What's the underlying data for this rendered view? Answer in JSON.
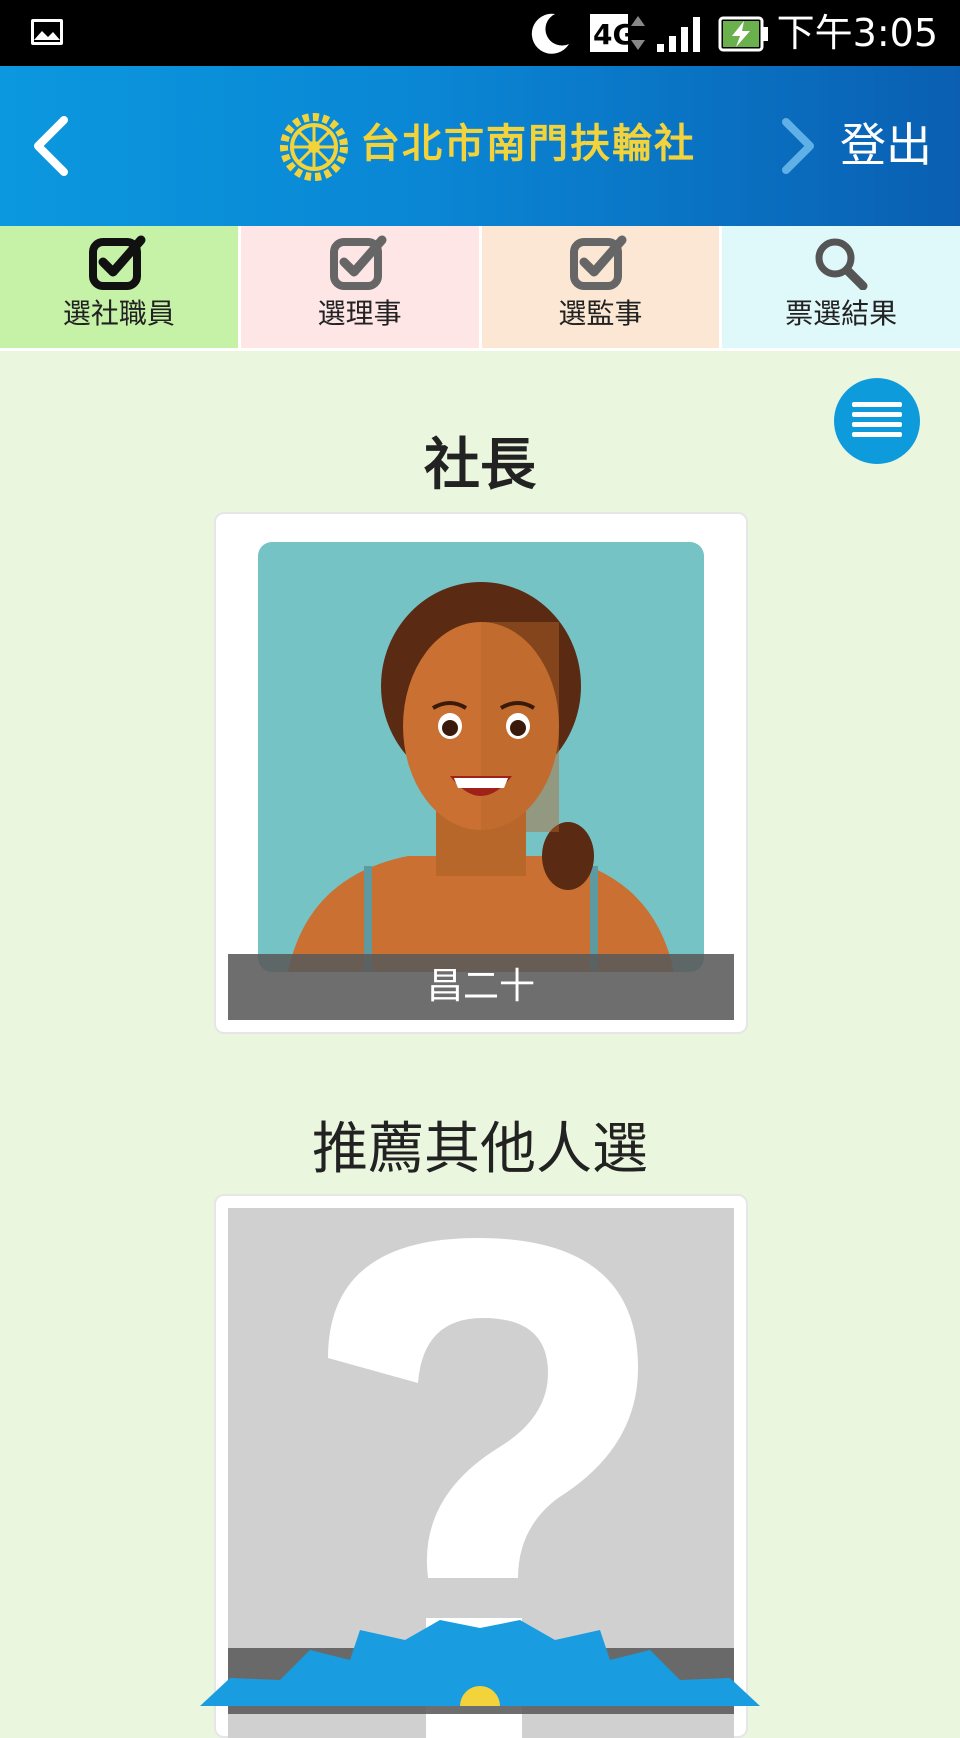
{
  "status_bar": {
    "network": "4G",
    "time": "下午3:05"
  },
  "header": {
    "title": "台北市南門扶輪社",
    "logout_label": "登出",
    "colors": {
      "title": "#f3d33b",
      "bar": "#0a86d4"
    }
  },
  "tabs": [
    {
      "label": "選社職員",
      "icon": "checkbox-icon",
      "color": "#c6f2a8"
    },
    {
      "label": "選理事",
      "icon": "checkbox-icon",
      "color": "#ffe6e6"
    },
    {
      "label": "選監事",
      "icon": "checkbox-icon",
      "color": "#fbe7d3"
    },
    {
      "label": "票選結果",
      "icon": "search-icon",
      "color": "#dff8fa"
    }
  ],
  "main": {
    "position_title": "社長",
    "candidate_name": "昌二十",
    "recommend_title": "推薦其他人選",
    "recommend_caption": "推薦其他人選"
  }
}
